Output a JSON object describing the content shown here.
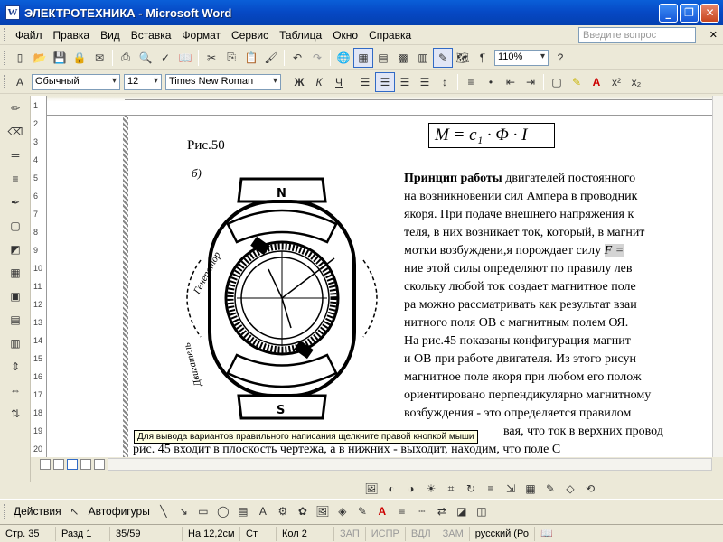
{
  "window": {
    "title": "ЭЛЕКТРОТЕХНИКА - Microsoft Word"
  },
  "menu": {
    "items": [
      "Файл",
      "Правка",
      "Вид",
      "Вставка",
      "Формат",
      "Сервис",
      "Таблица",
      "Окно",
      "Справка"
    ],
    "help_placeholder": "Введите вопрос"
  },
  "toolbar": {
    "zoom": "110%",
    "style": "Обычный",
    "font_size": "12",
    "font_name": "Times New Roman",
    "bold": "Ж",
    "italic": "К",
    "underline": "Ч",
    "pilcrow": "¶",
    "superscript": "x²",
    "subscript": "x₂"
  },
  "ruler": {
    "vertical_marks": [
      "1",
      "2",
      "3",
      "4",
      "5",
      "6",
      "7",
      "8",
      "9",
      "10",
      "11",
      "12",
      "13",
      "14",
      "15",
      "16",
      "17",
      "18",
      "19",
      "20"
    ]
  },
  "document": {
    "fig_caption": "Рис.50",
    "formula": "M = c₁ · Φ · I",
    "motor_labels": {
      "north": "N",
      "south": "S",
      "generator": "Генератор",
      "motor": "Двигатель",
      "fig_b": "б)"
    },
    "lines": [
      {
        "bold": "Принцип работы",
        "text": " двигателей постоянного"
      },
      {
        "text": "на возникновении сил Ампера в проводник"
      },
      {
        "text": "якоря. При подаче внешнего напряжения к"
      },
      {
        "text": "теля, в них возникает ток, который, в магнит"
      },
      {
        "text": "мотки возбуждени,я порождает силу ",
        "hl": "F ="
      },
      {
        "text": "ние этой силы определяют по правилу лев"
      },
      {
        "text": "скольку любой ток создает магнитное поле"
      },
      {
        "text": "ра можно рассматривать как результат взаи"
      },
      {
        "text": "нитного поля ОВ с магнитным полем ОЯ."
      },
      {
        "text": "  На рис.45 показаны конфигурация магнит"
      },
      {
        "text": "и ОВ при работе двигателя. Из этого рисун"
      },
      {
        "text": "магнитное поле якоря при любом его полож"
      },
      {
        "text": "ориентировано перпендикулярно магнитному"
      },
      {
        "text": "возбуждения - это определяется правилом"
      },
      {
        "text": "вая, что ток в верхних провод"
      },
      {
        "text": "рис. 45 входит в плоскость чертежа, а в нижних - выходит, находим, что поле С"
      }
    ],
    "tooltip": "Для вывода вариантов правильного написания щелкните правой кнопкой мыши"
  },
  "drawing": {
    "actions": "Действия",
    "autoshapes": "Автофигуры"
  },
  "status": {
    "page": "Стр. 35",
    "section": "Разд 1",
    "pages": "35/59",
    "position": "На 12,2см",
    "line": "Ст",
    "column": "Кол 2",
    "rec": "ЗАП",
    "trk": "ИСПР",
    "ext": "ВДЛ",
    "ovr": "ЗАМ",
    "language": "русский (Ро"
  }
}
